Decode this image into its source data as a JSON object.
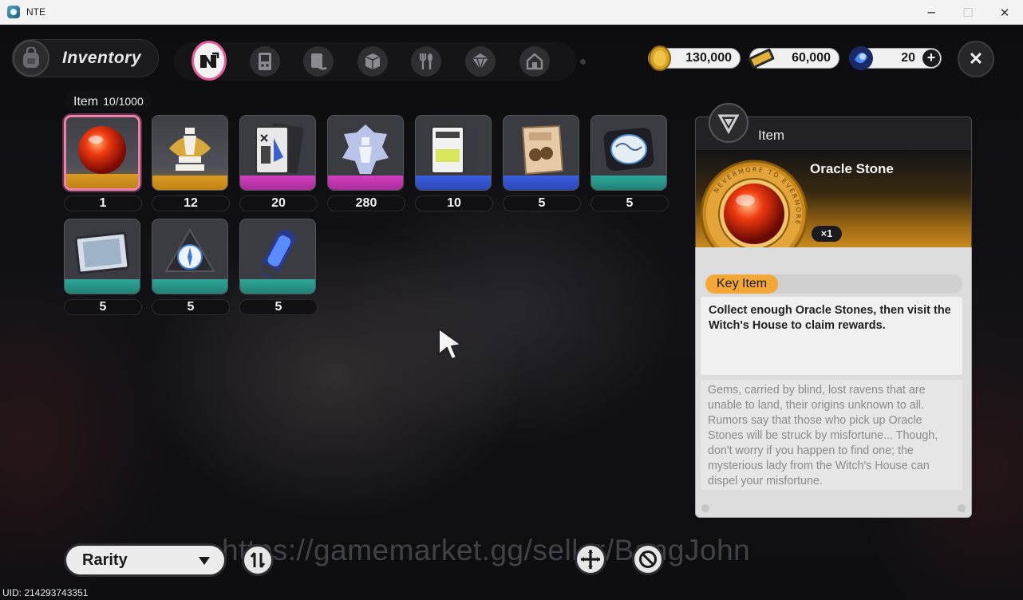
{
  "window": {
    "title": "NTE",
    "minimize": "─",
    "maximize": "☐",
    "close": "✕"
  },
  "header": {
    "title": "Inventory"
  },
  "tabs": [
    {
      "name": "tab-featured",
      "icon": "n-logo-icon",
      "active": true
    },
    {
      "name": "tab-gadgets",
      "icon": "handheld-console-icon"
    },
    {
      "name": "tab-documents",
      "icon": "document-icon"
    },
    {
      "name": "tab-materials",
      "icon": "cube-icon"
    },
    {
      "name": "tab-food",
      "icon": "fork-spoon-icon"
    },
    {
      "name": "tab-parts",
      "icon": "gem-box-icon"
    },
    {
      "name": "tab-housing",
      "icon": "house-icon"
    }
  ],
  "currencies": [
    {
      "icon": "gold-coin-icon",
      "value": "130,000"
    },
    {
      "icon": "ticket-icon",
      "value": "60,000"
    },
    {
      "icon": "blue-crystal-icon",
      "value": "20",
      "plus": "+"
    }
  ],
  "close_label": "✕",
  "inventory": {
    "label": "Item",
    "count": "10/1000"
  },
  "items": [
    {
      "name": "Oracle Stone",
      "qty": "1",
      "rarity": "gold",
      "icon": "red-orb-icon",
      "selected": true
    },
    {
      "name": "chess-piece",
      "qty": "12",
      "rarity": "gold",
      "icon": "chess-piece-icon"
    },
    {
      "name": "document-card",
      "qty": "20",
      "rarity": "pink",
      "icon": "document-card-icon"
    },
    {
      "name": "crystal-statue",
      "qty": "280",
      "rarity": "pink",
      "icon": "crystal-statue-icon"
    },
    {
      "name": "card-deck",
      "qty": "10",
      "rarity": "blue",
      "icon": "card-deck-icon"
    },
    {
      "name": "snack-bag",
      "qty": "5",
      "rarity": "blue",
      "icon": "snack-bag-icon"
    },
    {
      "name": "map-device",
      "qty": "5",
      "rarity": "teal",
      "icon": "map-device-icon"
    },
    {
      "name": "photo-frame",
      "qty": "5",
      "rarity": "teal",
      "icon": "photo-frame-icon"
    },
    {
      "name": "compass-shard",
      "qty": "5",
      "rarity": "teal",
      "icon": "compass-icon"
    },
    {
      "name": "energy-canister",
      "qty": "5",
      "rarity": "teal",
      "icon": "canister-icon"
    }
  ],
  "detail": {
    "type": "Item",
    "name": "Oracle Stone",
    "qty": "×1",
    "tag": "Key Item",
    "description": "Collect enough Oracle Stones, then visit the Witch's House to claim rewards.",
    "lore": "Gems, carried by blind, lost ravens that are unable to land, their origins unknown to all. Rumors say that those who pick up Oracle Stones will be struck by misfortune... Though, don't worry if you happen to find one; the mysterious lady from the Witch's House can dispel your misfortune.",
    "ring_text": "NEVERMORE TO EVERMORE"
  },
  "bottom": {
    "sort_label": "Rarity"
  },
  "watermark": "https://gamemarket.gg/seller/BangJohn",
  "uid": "UID: 214293743351",
  "colors": {
    "accent_pink": "#e85a9a",
    "gold": "#d89a22",
    "key_tag": "#f2a736"
  }
}
